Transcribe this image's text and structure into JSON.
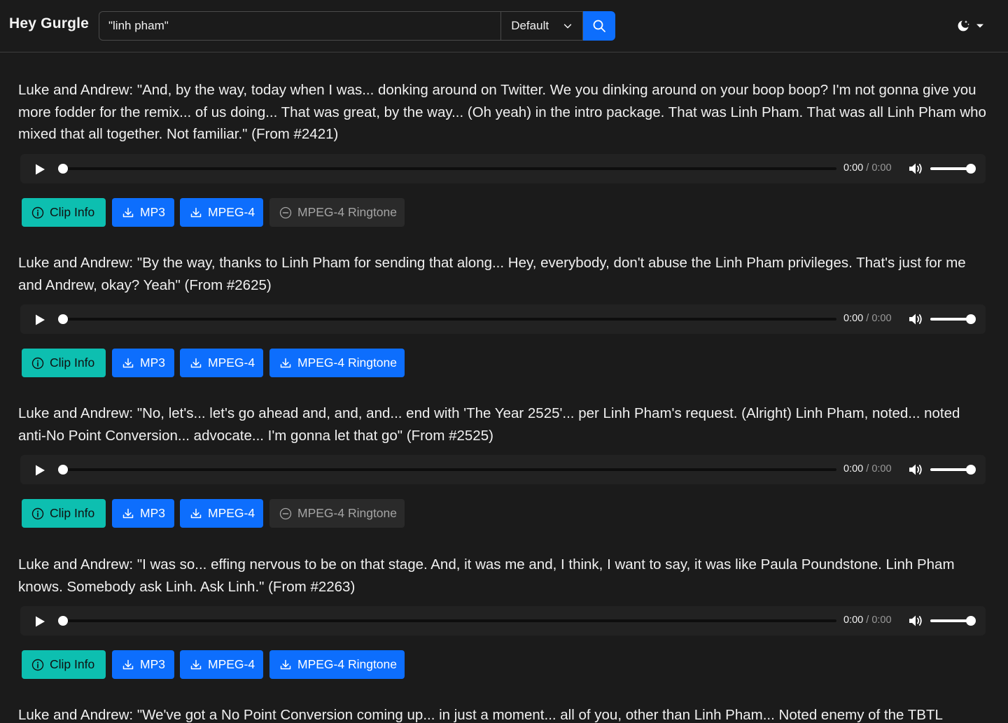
{
  "header": {
    "brand": "Hey Gurgle",
    "search_value": "\"linh pham\"",
    "sort_label": "Default"
  },
  "icons": {
    "search": "search-icon",
    "theme": "moon-stars-icon",
    "caret": "caret-down-icon",
    "play": "play-icon",
    "volume": "volume-icon",
    "info": "info-circle-icon",
    "download": "download-icon",
    "disabled": "dash-circle-icon"
  },
  "colors": {
    "background": "#1b1b1b",
    "primary": "#0d6efd",
    "info": "#0dbfb0",
    "disabled": "#2a2a2a"
  },
  "player": {
    "current_time": "0:00",
    "separator": "/",
    "duration": "0:00",
    "progress": 0,
    "volume": 1
  },
  "buttons": {
    "clip_info": "Clip Info",
    "mp3": "MP3",
    "mpeg4": "MPEG-4",
    "ringtone": "MPEG-4 Ringtone"
  },
  "results": [
    {
      "text": "Luke and Andrew: \"And, by the way, today when I was... donking around on Twitter. We you dinking around on your boop boop? I'm not gonna give you more fodder for the remix... of us doing... That was great, by the way... (Oh yeah) in the intro package. That was Linh Pham. That was all Linh Pham who mixed that all together. Not familiar.\" (From #2421)",
      "ringtone_available": false
    },
    {
      "text": "Luke and Andrew: \"By the way, thanks to Linh Pham for sending that along... Hey, everybody, don't abuse the Linh Pham privileges. That's just for me and Andrew, okay? Yeah\" (From #2625)",
      "ringtone_available": true
    },
    {
      "text": "Luke and Andrew: \"No, let's... let's go ahead and, and, and... end with 'The Year 2525'... per Linh Pham's request. (Alright) Linh Pham, noted... noted anti-No Point Conversion... advocate... I'm gonna let that go\" (From #2525)",
      "ringtone_available": false
    },
    {
      "text": "Luke and Andrew: \"I was so... effing nervous to be on that stage. And, it was me and, I think, I want to say, it was like Paula Poundstone. Linh Pham knows. Somebody ask Linh. Ask Linh.\" (From #2263)",
      "ringtone_available": true
    },
    {
      "text": "Luke and Andrew: \"We've got a No Point Conversion coming up... in just a moment... all of you, other than Linh Pham... Noted enemy of the TBTL",
      "ringtone_available": null
    }
  ]
}
